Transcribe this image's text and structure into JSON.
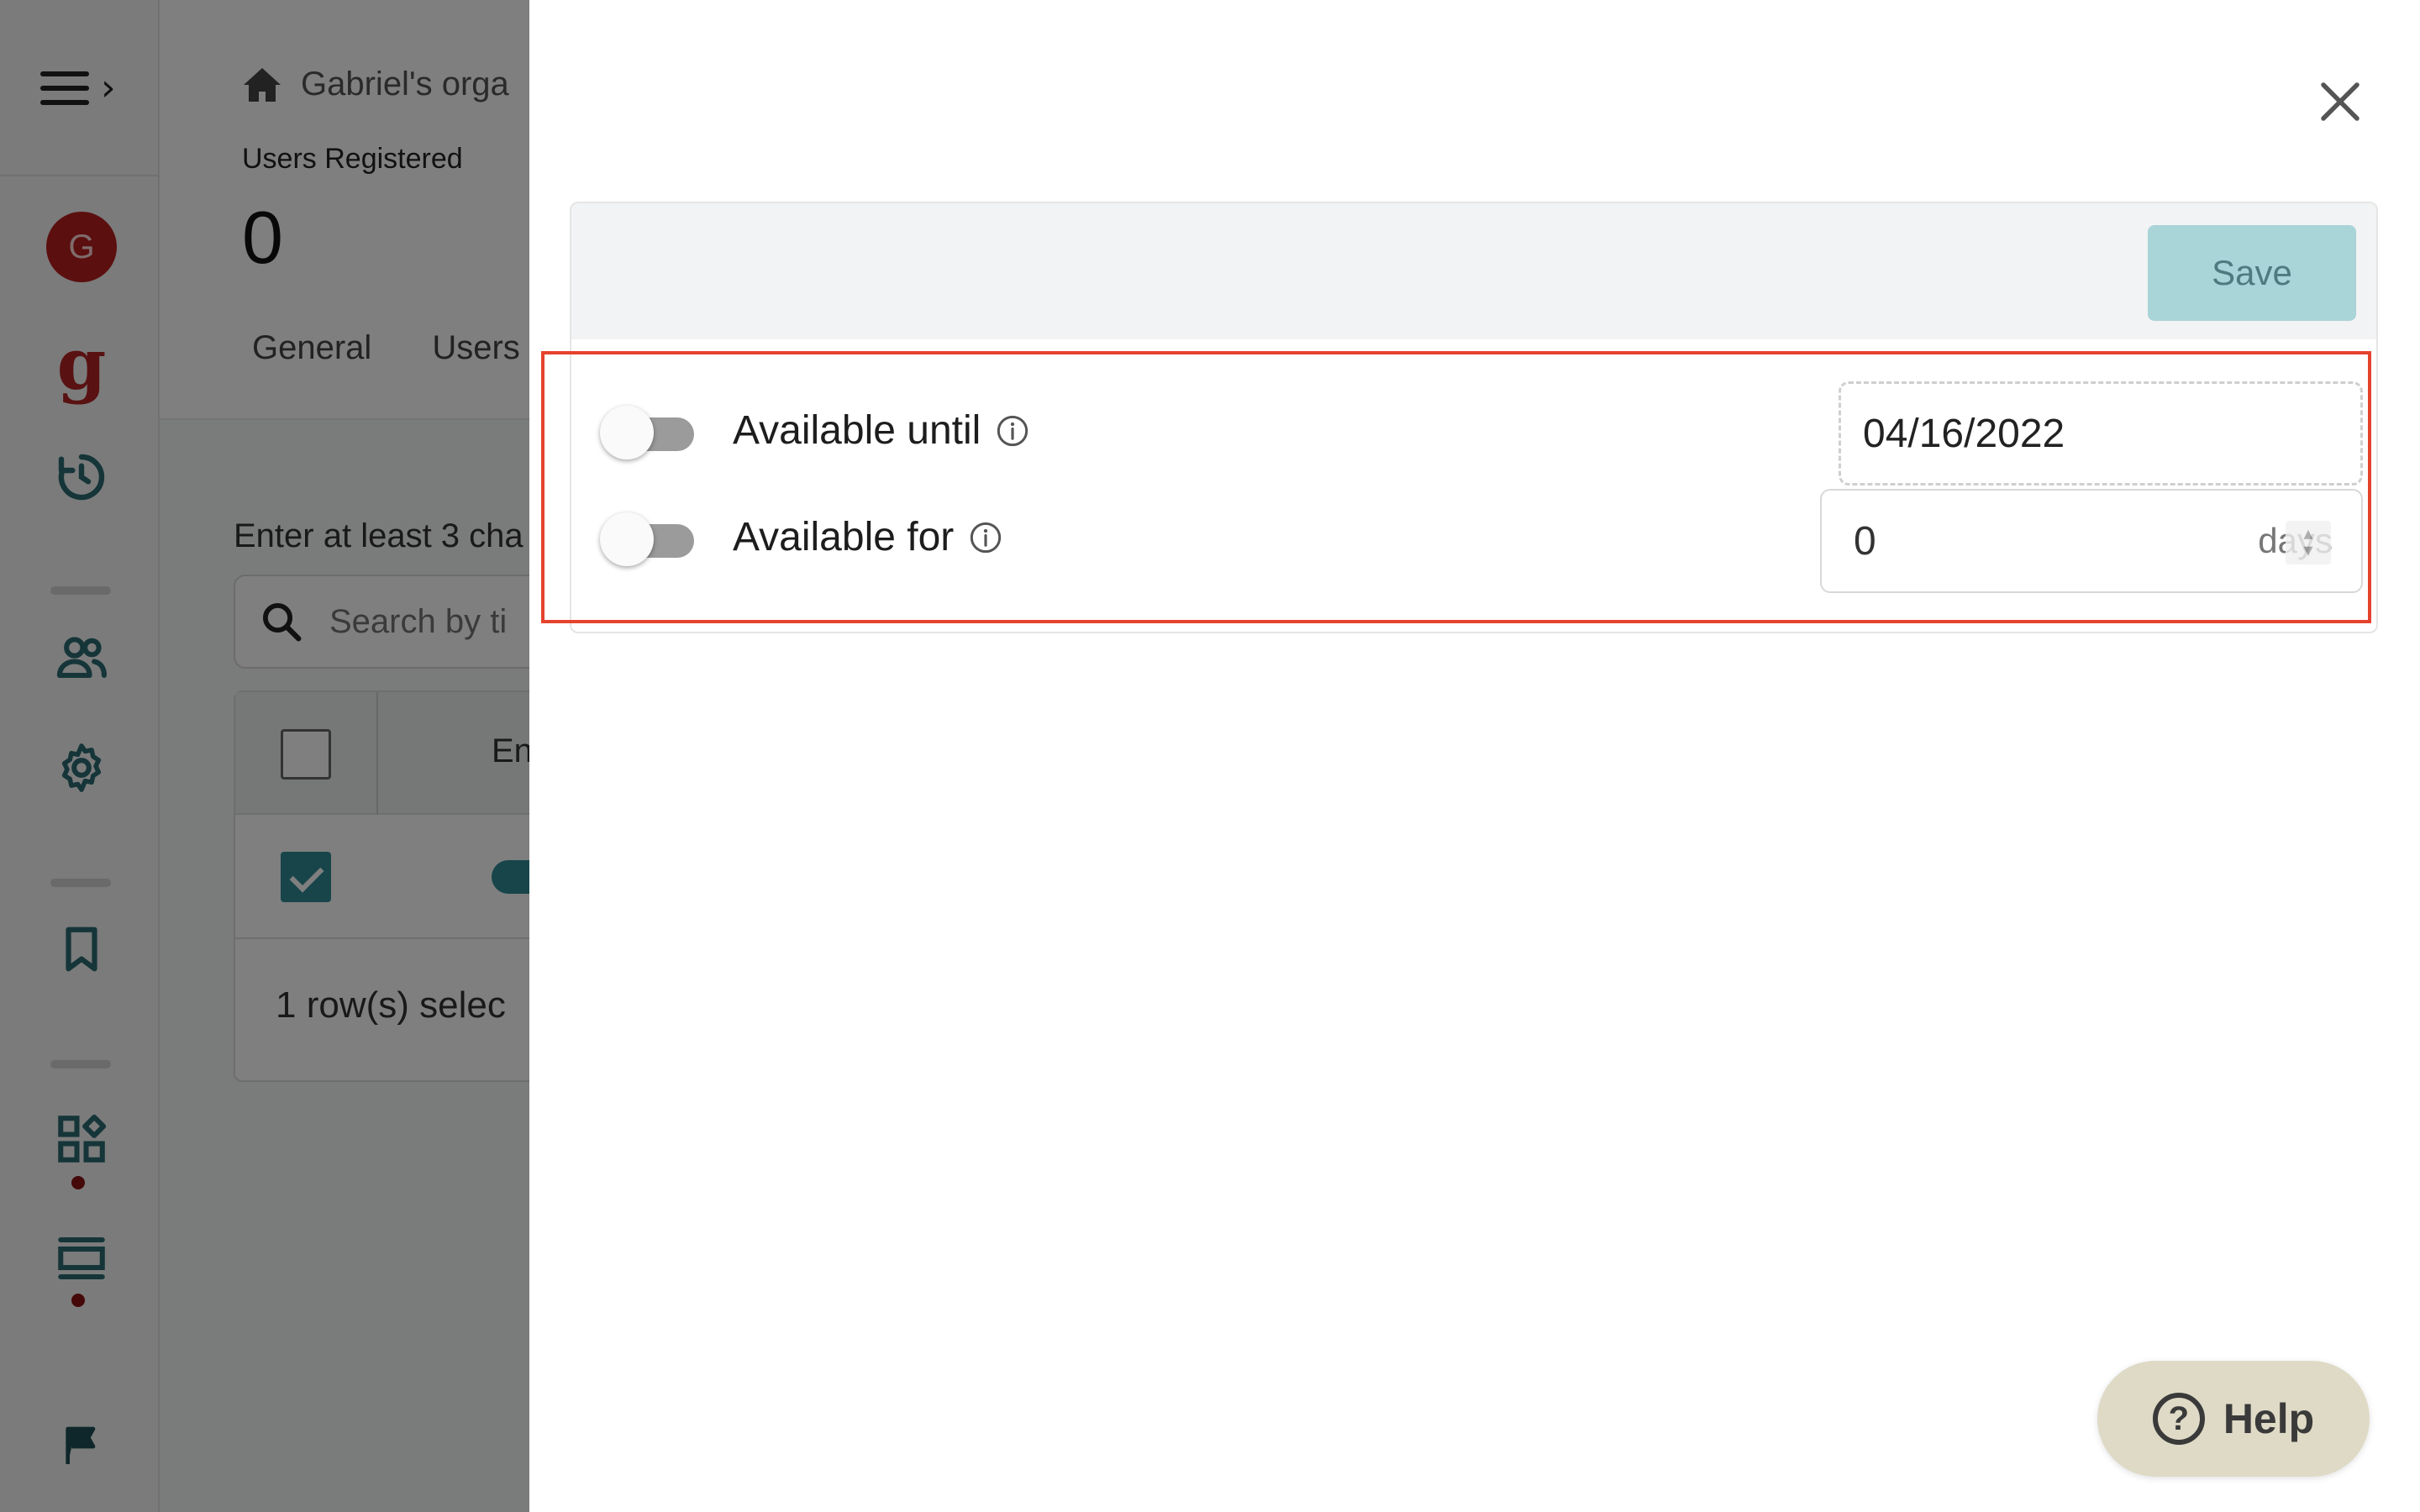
{
  "sidebar": {
    "avatar_initial": "G",
    "logo_letter": "g"
  },
  "background": {
    "breadcrumb": "Gabriel's orga",
    "stat_label": "Users Registered",
    "stat_value": "0",
    "tabs": [
      {
        "label": "General"
      },
      {
        "label": "Users"
      }
    ],
    "search_hint": "Enter at least 3 cha",
    "search_placeholder": "Search by ti",
    "table_header": "En",
    "selected_text": "1 row(s) selec"
  },
  "drawer": {
    "save_label": "Save",
    "settings": [
      {
        "label": "Available until",
        "enabled": false
      },
      {
        "label": "Available for",
        "enabled": false
      }
    ],
    "date_value": "04/16/2022",
    "days_value": "0",
    "days_suffix": "days"
  },
  "help": {
    "label": "Help",
    "glyph": "?"
  },
  "colors": {
    "accent": "#2e8b95",
    "brand_red": "#b22222",
    "highlight": "#e4432d",
    "save_bg": "#a9d4d8",
    "help_bg": "#dedac6"
  }
}
